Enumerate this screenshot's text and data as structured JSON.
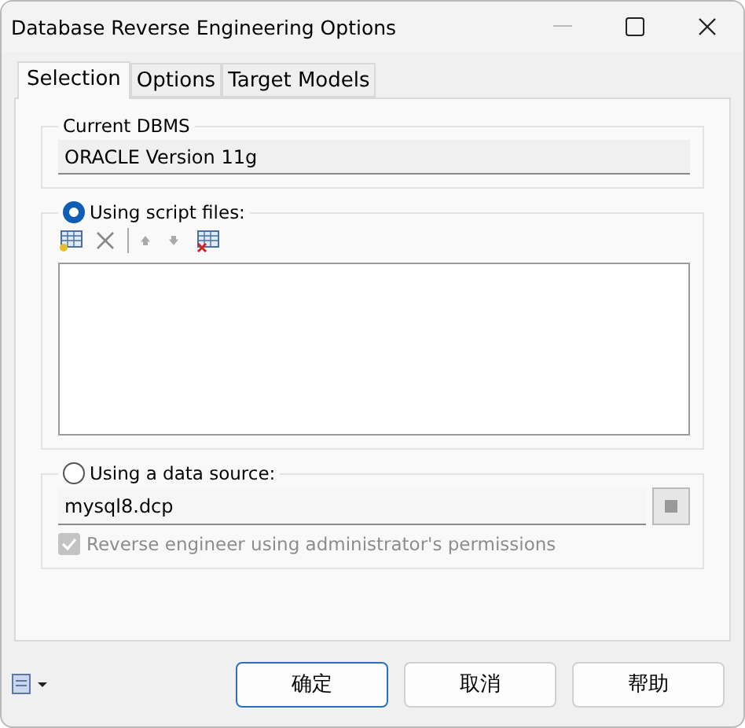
{
  "window": {
    "title": "Database Reverse Engineering Options"
  },
  "tabs": [
    {
      "label": "Selection",
      "selected": true
    },
    {
      "label": "Options",
      "selected": false
    },
    {
      "label": "Target Models",
      "selected": false
    }
  ],
  "current_dbms": {
    "label": "Current DBMS",
    "value": "ORACLE Version 11g"
  },
  "script_files": {
    "label": "Using script files:",
    "selected": true
  },
  "data_source": {
    "label": "Using a data source:",
    "selected": false,
    "value": "mysql8.dcp",
    "admin_permissions": {
      "label": "Reverse engineer using administrator's permissions",
      "checked": true,
      "disabled": true
    }
  },
  "buttons": [
    {
      "label": "确定",
      "default": true
    },
    {
      "label": "取消",
      "default": false
    },
    {
      "label": "帮助",
      "default": false
    }
  ]
}
